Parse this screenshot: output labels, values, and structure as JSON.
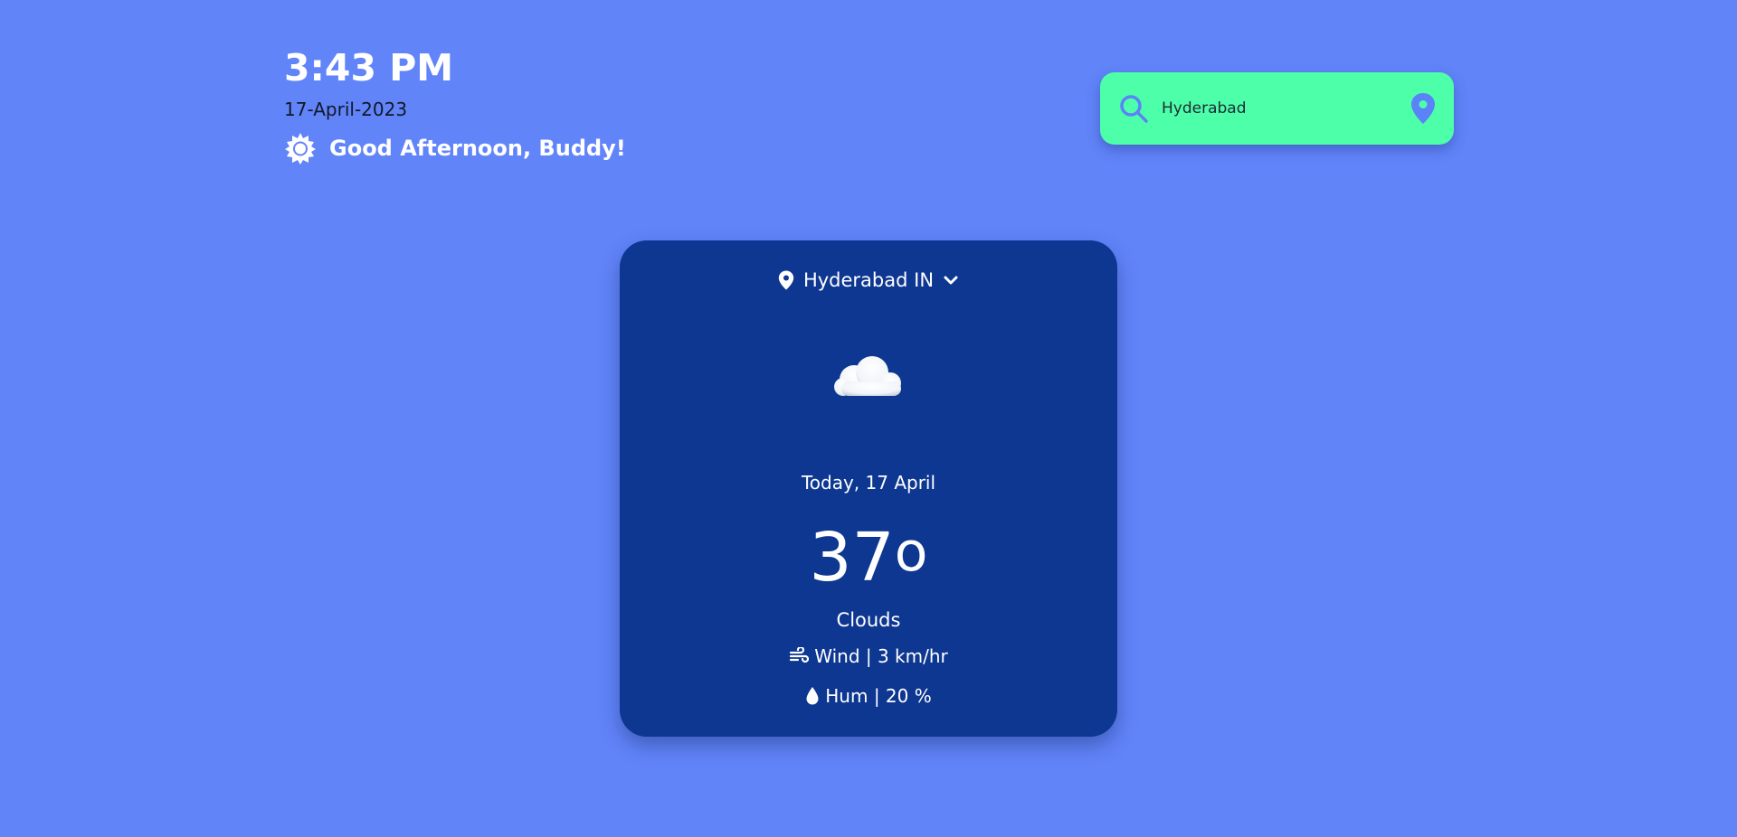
{
  "header": {
    "time": "3:43 PM",
    "date": "17-April-2023",
    "greeting": "Good Afternoon, Buddy!",
    "greeting_icon": "sun-icon"
  },
  "search": {
    "value": "Hyderabad",
    "search_icon": "search-icon",
    "location_icon": "map-pin-icon"
  },
  "card": {
    "location": "Hyderabad IN",
    "location_icon": "map-pin-icon",
    "dropdown_icon": "chevron-down-icon",
    "weather_icon": "cloud-icon",
    "today": "Today, 17 April",
    "temperature": "37",
    "degree_symbol": "o",
    "condition": "Clouds",
    "wind": "Wind | 3 km/hr",
    "wind_icon": "wind-icon",
    "humidity": "Hum | 20 %",
    "humidity_icon": "droplet-icon"
  },
  "colors": {
    "background": "#6184f9",
    "card": "#0d3791",
    "search_bg": "#4dffa8",
    "icon_accent": "#5b82f8"
  }
}
